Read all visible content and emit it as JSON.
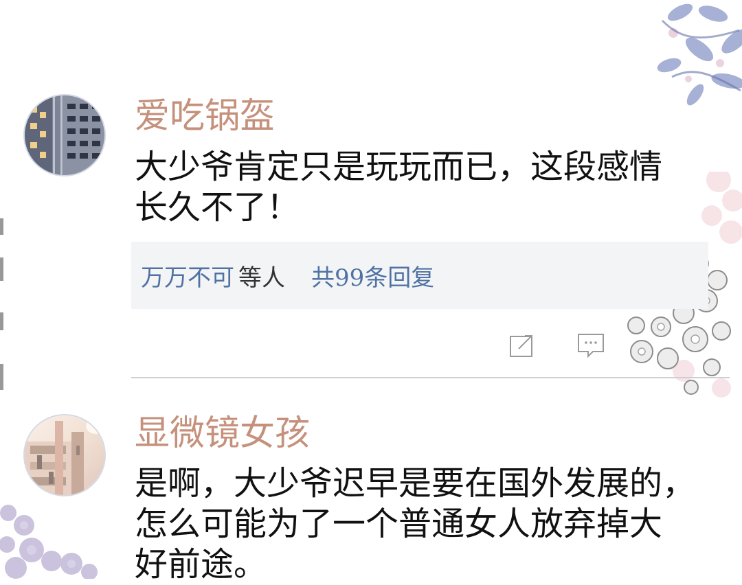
{
  "comments": [
    {
      "username": "爱吃锅盔",
      "text": "大少爷肯定只是玩玩而已，这段感情\n长久不了！",
      "replies": {
        "replier": "万万不可",
        "meta": "等人",
        "count": "共99条回复"
      },
      "actions": [
        "share-icon",
        "comment-icon"
      ]
    },
    {
      "username": "显微镜女孩",
      "text": "是啊，大少爷迟早是要在国外发展的，\n怎么可能为了一个普通女人放弃掉大\n好前途。"
    }
  ],
  "colors": {
    "username": "#c5917c",
    "reply_link": "#4f71a3",
    "reply_bg": "#f3f4f6",
    "divider": "#cfcfcf"
  },
  "icons": [
    "building-avatar-icon",
    "sunlit-building-avatar-icon",
    "share-icon",
    "comment-icon",
    "flower-decoration-icon"
  ]
}
